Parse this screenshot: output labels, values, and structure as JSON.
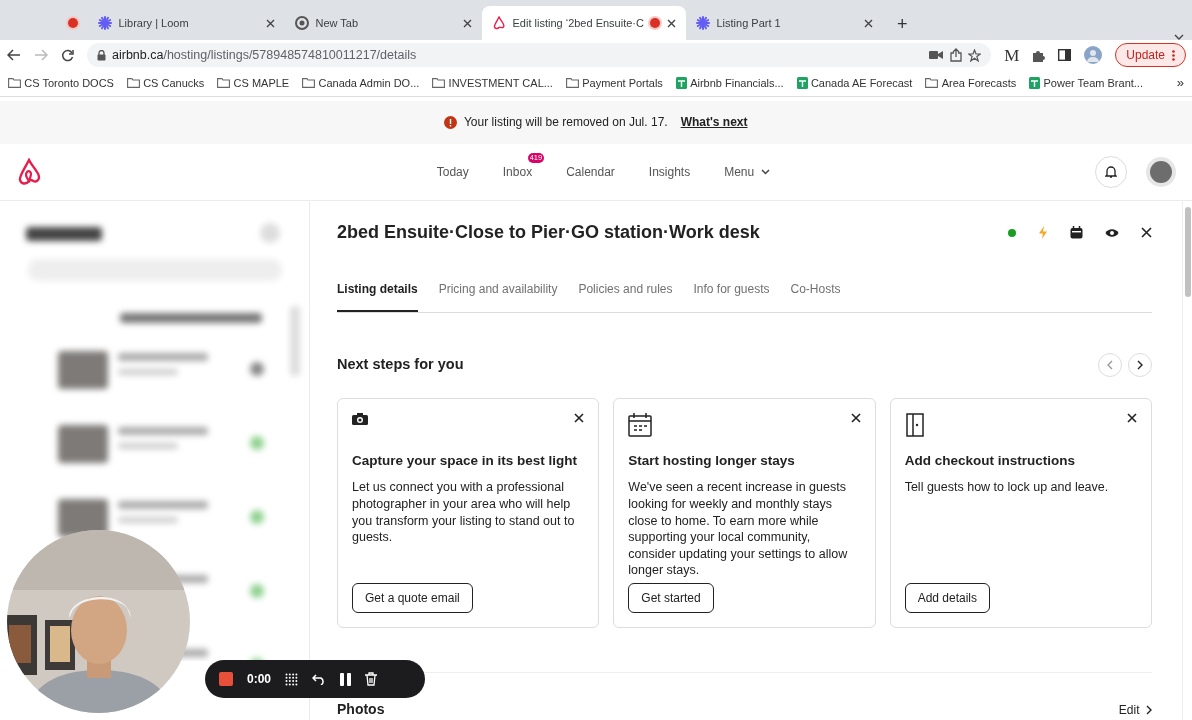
{
  "browser": {
    "tabs": [
      {
        "kind": "pinned",
        "recording": true,
        "selected": false
      },
      {
        "kind": "loom",
        "title": "Library | Loom",
        "recording": false,
        "selected": false
      },
      {
        "kind": "chrome",
        "title": "New Tab",
        "recording": false,
        "selected": false
      },
      {
        "kind": "airbnb",
        "title": "Edit listing ‘2bed Ensuite·C",
        "recording": true,
        "selected": true
      },
      {
        "kind": "loom",
        "title": "Listing Part 1",
        "recording": false,
        "selected": false
      }
    ],
    "new_tab": "+",
    "url_host": "airbnb.ca",
    "url_path": "/hosting/listings/578948574810011217/details",
    "extension_letter": "M",
    "update_label": "Update",
    "bookmarks": [
      {
        "kind": "folder",
        "label": "CS Toronto DOCS"
      },
      {
        "kind": "folder",
        "label": "CS Canucks"
      },
      {
        "kind": "folder",
        "label": "CS MAPLE"
      },
      {
        "kind": "folder",
        "label": "Canada Admin DO..."
      },
      {
        "kind": "folder",
        "label": "INVESTMENT CAL..."
      },
      {
        "kind": "folder",
        "label": "Payment Portals"
      },
      {
        "kind": "sheet",
        "label": "Airbnb Financials..."
      },
      {
        "kind": "sheet",
        "label": "Canada AE Forecast"
      },
      {
        "kind": "folder",
        "label": "Area Forecasts"
      },
      {
        "kind": "sheet",
        "label": "Power Team Brant..."
      }
    ],
    "bookmarks_overflow": "»"
  },
  "banner": {
    "text": "Your listing will be removed on Jul. 17.",
    "link": "What's next"
  },
  "header": {
    "nav": [
      {
        "label": "Today"
      },
      {
        "label": "Inbox",
        "badge": "419"
      },
      {
        "label": "Calendar"
      },
      {
        "label": "Insights"
      },
      {
        "label": "Menu",
        "dropdown": true
      }
    ]
  },
  "listing": {
    "title": "2bed Ensuite·Close to Pier·GO station·Work desk",
    "tabs": [
      {
        "label": "Listing details",
        "selected": true
      },
      {
        "label": "Pricing and availability",
        "selected": false
      },
      {
        "label": "Policies and rules",
        "selected": false
      },
      {
        "label": "Info for guests",
        "selected": false
      },
      {
        "label": "Co-Hosts",
        "selected": false
      }
    ],
    "next_steps": {
      "title": "Next steps for you",
      "cards": [
        {
          "kind": "camera",
          "title": "Capture your space in its best light",
          "body": "Let us connect you with a professional photographer in your area who will help you transform your listing to stand out to guests.",
          "button": "Get a quote email"
        },
        {
          "kind": "calendar",
          "title": "Start hosting longer stays",
          "body": "We've seen a recent increase in guests looking for weekly and monthly stays close to home. To earn more while supporting your local community, consider updating your settings to allow longer stays.",
          "button": "Get started"
        },
        {
          "kind": "door",
          "title": "Add checkout instructions",
          "body": "Tell guests how to lock up and leave.",
          "button": "Add details"
        }
      ]
    },
    "photos": {
      "title": "Photos",
      "edit": "Edit"
    }
  },
  "recorder": {
    "time": "0:00",
    "recording": true
  }
}
